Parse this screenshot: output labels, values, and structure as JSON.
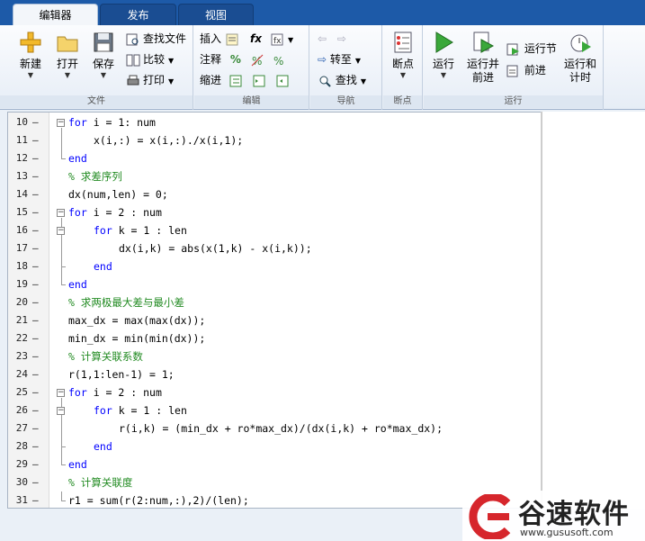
{
  "tabs": [
    {
      "label": "编辑器",
      "active": true
    },
    {
      "label": "发布",
      "active": false
    },
    {
      "label": "视图",
      "active": false
    }
  ],
  "ribbon": {
    "file": {
      "section_label": "文件",
      "new_label": "新建",
      "open_label": "打开",
      "save_label": "保存",
      "find_files_label": "查找文件",
      "compare_label": "比较",
      "print_label": "打印"
    },
    "edit": {
      "section_label": "编辑",
      "insert_label": "插入",
      "comment_label": "注释",
      "indent_label": "缩进",
      "fx_label": "fx"
    },
    "navigate": {
      "section_label": "导航",
      "goto_label": "转至",
      "find_label": "查找"
    },
    "breakpoints": {
      "section_label": "断点",
      "breakpoints_label": "断点"
    },
    "run": {
      "section_label": "运行",
      "run_label": "运行",
      "run_advance_label_1": "运行并",
      "run_advance_label_2": "前进",
      "run_section_label": "运行节",
      "advance_label": "前进",
      "run_time_label_1": "运行和",
      "run_time_label_2": "计时"
    }
  },
  "editor": {
    "lines": [
      {
        "num": "10",
        "indent": 0,
        "tokens": [
          {
            "t": "for",
            "c": "kw"
          },
          {
            "t": " i = 1: num",
            "c": ""
          }
        ]
      },
      {
        "num": "11",
        "indent": 1,
        "tokens": [
          {
            "t": "x(i,:) = x(i,:)./x(i,1);",
            "c": ""
          }
        ]
      },
      {
        "num": "12",
        "indent": 0,
        "tokens": [
          {
            "t": "end",
            "c": "kw"
          }
        ]
      },
      {
        "num": "13",
        "indent": 0,
        "tokens": [
          {
            "t": "% 求差序列",
            "c": "cm"
          }
        ]
      },
      {
        "num": "14",
        "indent": 0,
        "tokens": [
          {
            "t": "dx(num,len) = 0;",
            "c": ""
          }
        ]
      },
      {
        "num": "15",
        "indent": 0,
        "tokens": [
          {
            "t": "for",
            "c": "kw"
          },
          {
            "t": " i = 2 : num",
            "c": ""
          }
        ]
      },
      {
        "num": "16",
        "indent": 1,
        "tokens": [
          {
            "t": "for",
            "c": "kw"
          },
          {
            "t": " k = 1 : len",
            "c": ""
          }
        ]
      },
      {
        "num": "17",
        "indent": 2,
        "tokens": [
          {
            "t": "dx(i,k) = abs(x(1,k) - x(i,k));",
            "c": ""
          }
        ]
      },
      {
        "num": "18",
        "indent": 1,
        "tokens": [
          {
            "t": "end",
            "c": "kw"
          }
        ]
      },
      {
        "num": "19",
        "indent": 0,
        "tokens": [
          {
            "t": "end",
            "c": "kw"
          }
        ]
      },
      {
        "num": "20",
        "indent": 0,
        "tokens": [
          {
            "t": "% 求两极最大差与最小差",
            "c": "cm"
          }
        ]
      },
      {
        "num": "21",
        "indent": 0,
        "tokens": [
          {
            "t": "max_dx = max(max(dx));",
            "c": ""
          }
        ]
      },
      {
        "num": "22",
        "indent": 0,
        "tokens": [
          {
            "t": "min_dx = min(min(dx));",
            "c": ""
          }
        ]
      },
      {
        "num": "23",
        "indent": 0,
        "tokens": [
          {
            "t": "% 计算关联系数",
            "c": "cm"
          }
        ]
      },
      {
        "num": "24",
        "indent": 0,
        "tokens": [
          {
            "t": "r(1,1:len-1) = 1;",
            "c": ""
          }
        ]
      },
      {
        "num": "25",
        "indent": 0,
        "tokens": [
          {
            "t": "for",
            "c": "kw"
          },
          {
            "t": " i = 2 : num",
            "c": ""
          }
        ]
      },
      {
        "num": "26",
        "indent": 1,
        "tokens": [
          {
            "t": "for",
            "c": "kw"
          },
          {
            "t": " k = 1 : len",
            "c": ""
          }
        ]
      },
      {
        "num": "27",
        "indent": 2,
        "tokens": [
          {
            "t": "r(i,k) = (min_dx + ro*max_dx)/(dx(i,k) + ro*max_dx);",
            "c": ""
          }
        ]
      },
      {
        "num": "28",
        "indent": 1,
        "tokens": [
          {
            "t": "end",
            "c": "kw"
          }
        ]
      },
      {
        "num": "29",
        "indent": 0,
        "tokens": [
          {
            "t": "end",
            "c": "kw"
          }
        ]
      },
      {
        "num": "30",
        "indent": 0,
        "tokens": [
          {
            "t": "% 计算关联度",
            "c": "cm"
          }
        ]
      },
      {
        "num": "31",
        "indent": 0,
        "tokens": [
          {
            "t": "r1 = sum(r(2:num,:),2)/(len);",
            "c": ""
          }
        ]
      }
    ]
  },
  "watermark": {
    "title": "谷速软件",
    "url": "www.gususoft.com"
  },
  "colors": {
    "keyword": "#0000ff",
    "comment": "#228b22",
    "tab_strip": "#1d5aa8",
    "run_green": "#3aa83a"
  }
}
